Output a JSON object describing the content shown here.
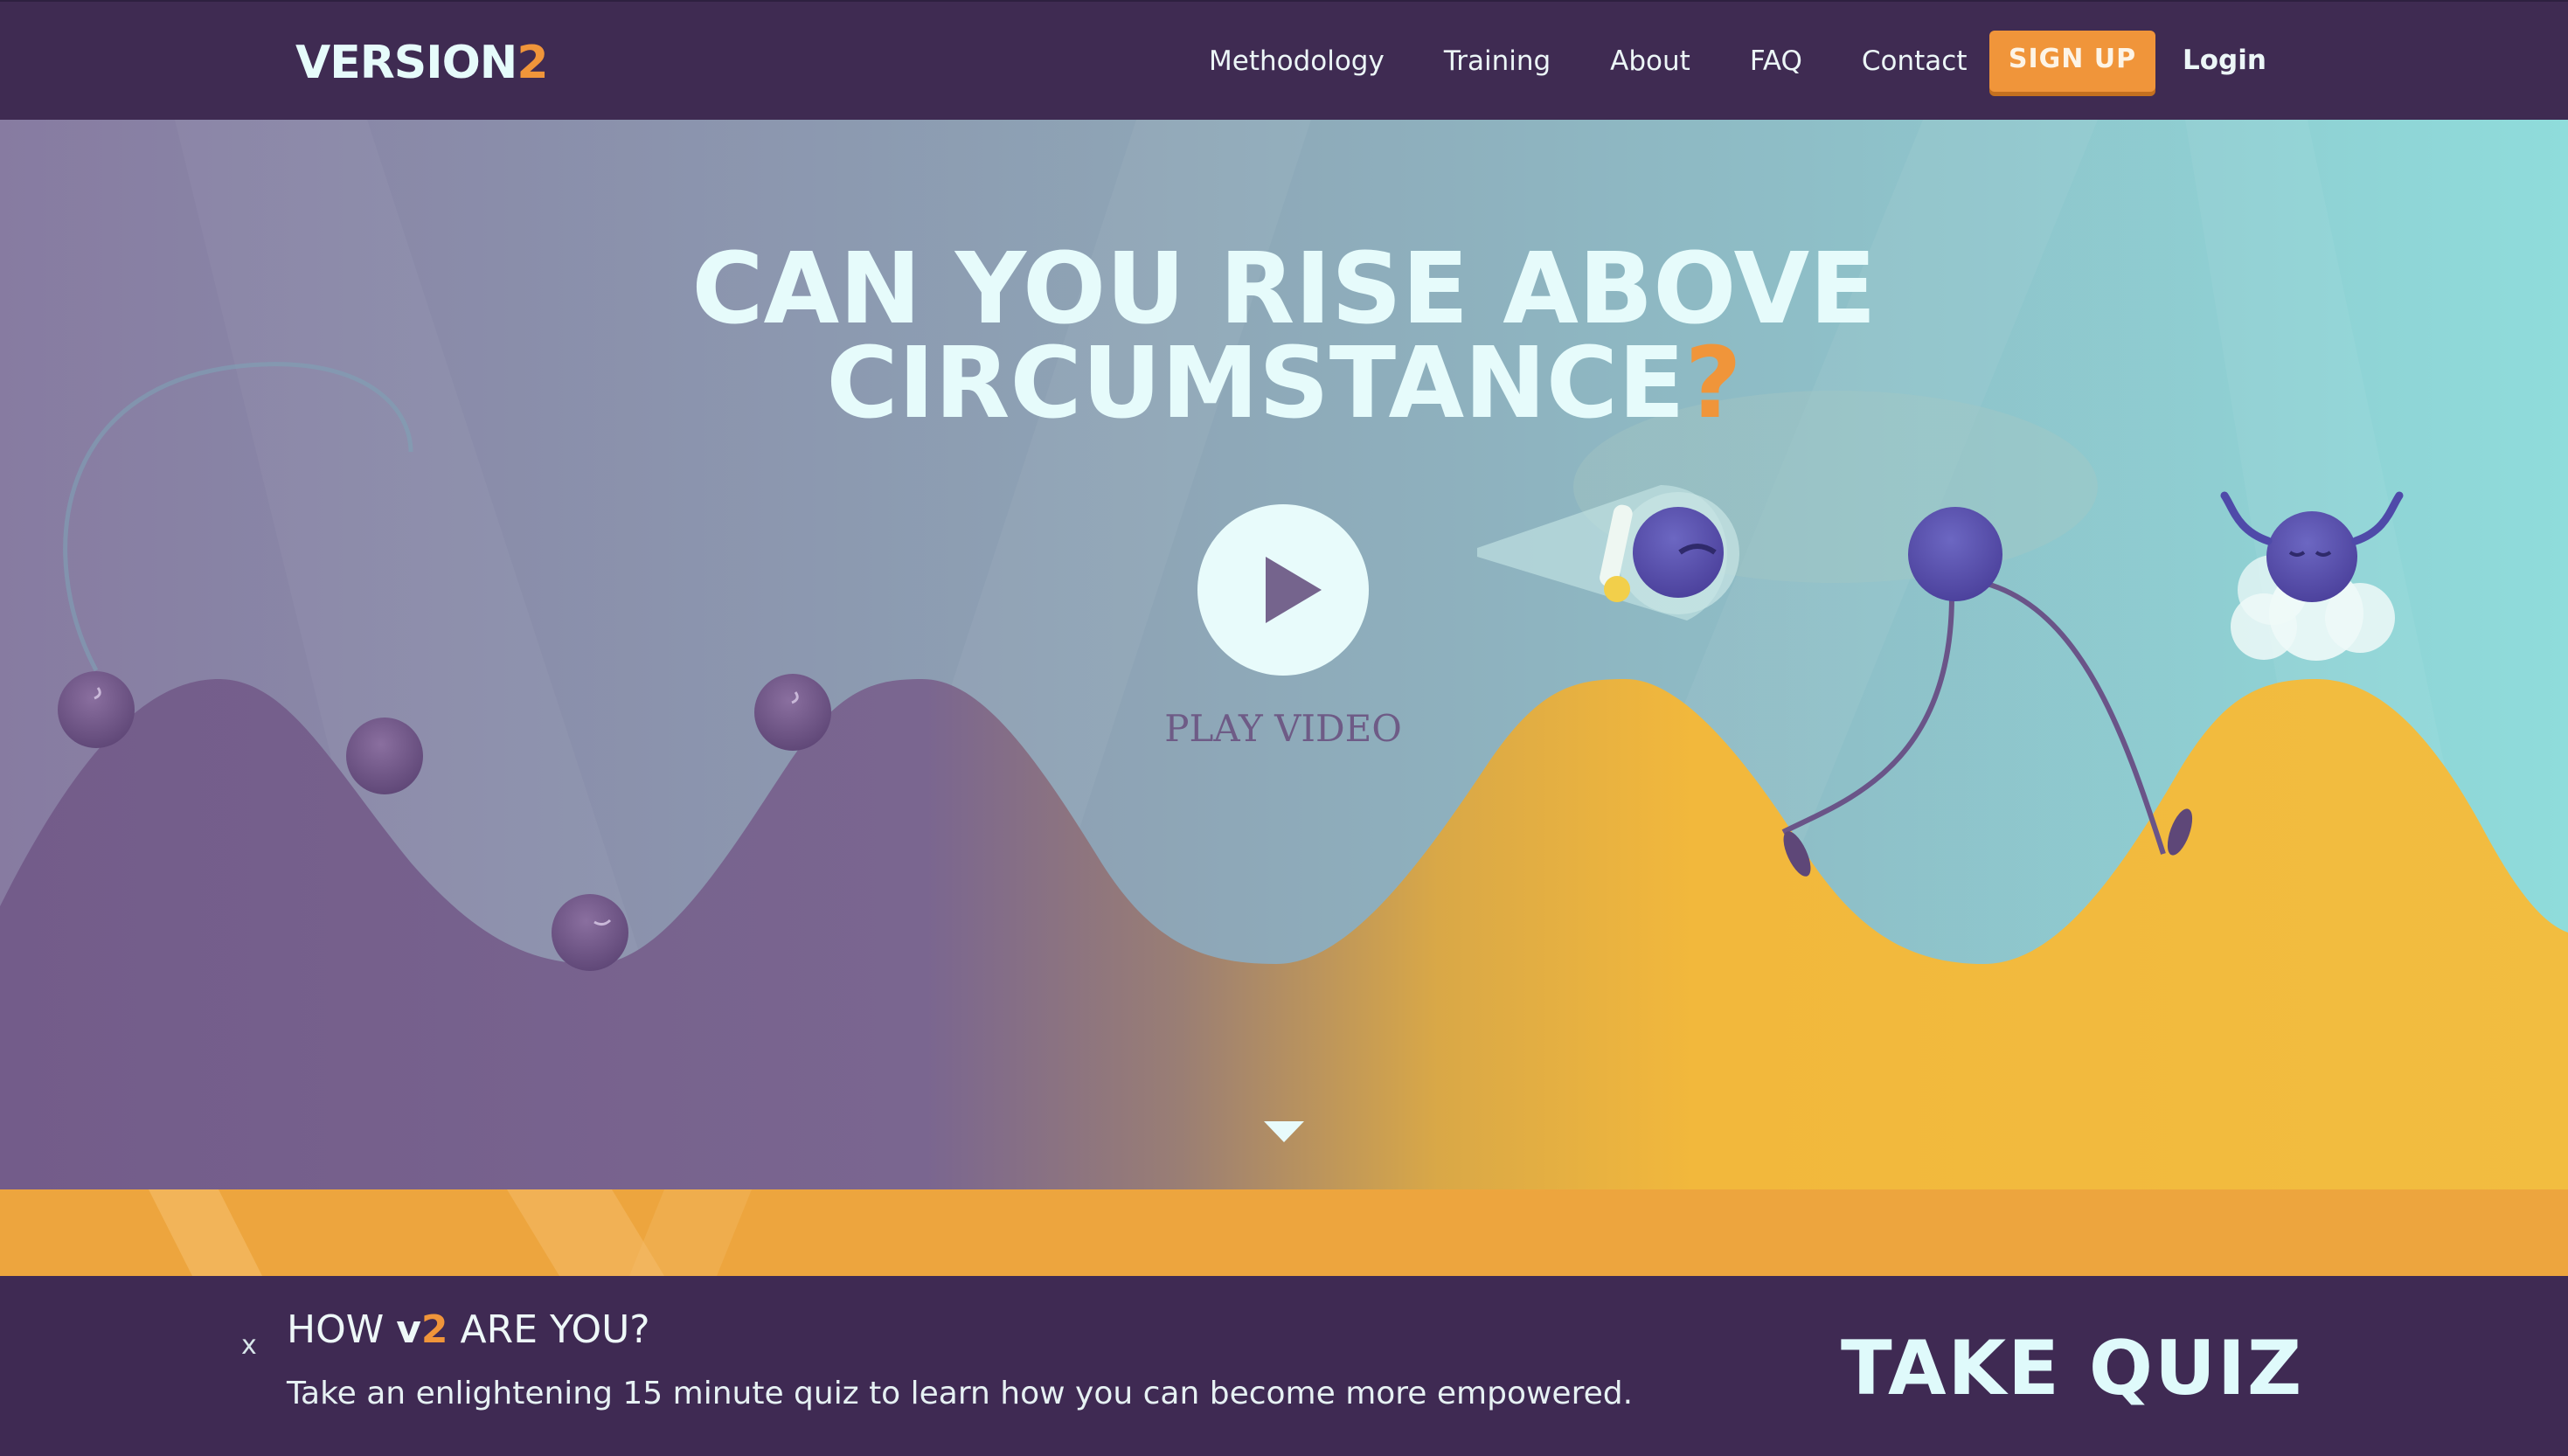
{
  "brand": {
    "logo_main": "VERSION",
    "logo_number": "2"
  },
  "nav": {
    "links": [
      "Methodology",
      "Training",
      "About",
      "FAQ",
      "Contact"
    ],
    "signup_label": "SIGN UP",
    "login_label": "Login"
  },
  "hero": {
    "headline_line1": "CAN YOU RISE ABOVE",
    "headline_line2": "CIRCUMSTANCE",
    "headline_mark": "?",
    "play_label": "PLAY VIDEO"
  },
  "quiz": {
    "close_label": "x",
    "title_prefix": "HOW ",
    "title_v": "v",
    "title_2": "2",
    "title_suffix": " ARE YOU?",
    "description": "Take an enlightening 15 minute quiz to learn how you can become more empowered.",
    "cta_label": "TAKE QUIZ"
  },
  "colors": {
    "nav_bg": "#3f2b52",
    "accent_orange": "#f0953a",
    "hill_purple": "#6e5684",
    "hill_yellow": "#f2b83c",
    "sky_teal": "#8fdcdb",
    "text_light": "#e6fbfb"
  },
  "icons": [
    "play-icon",
    "chevron-down-icon",
    "close-icon"
  ]
}
